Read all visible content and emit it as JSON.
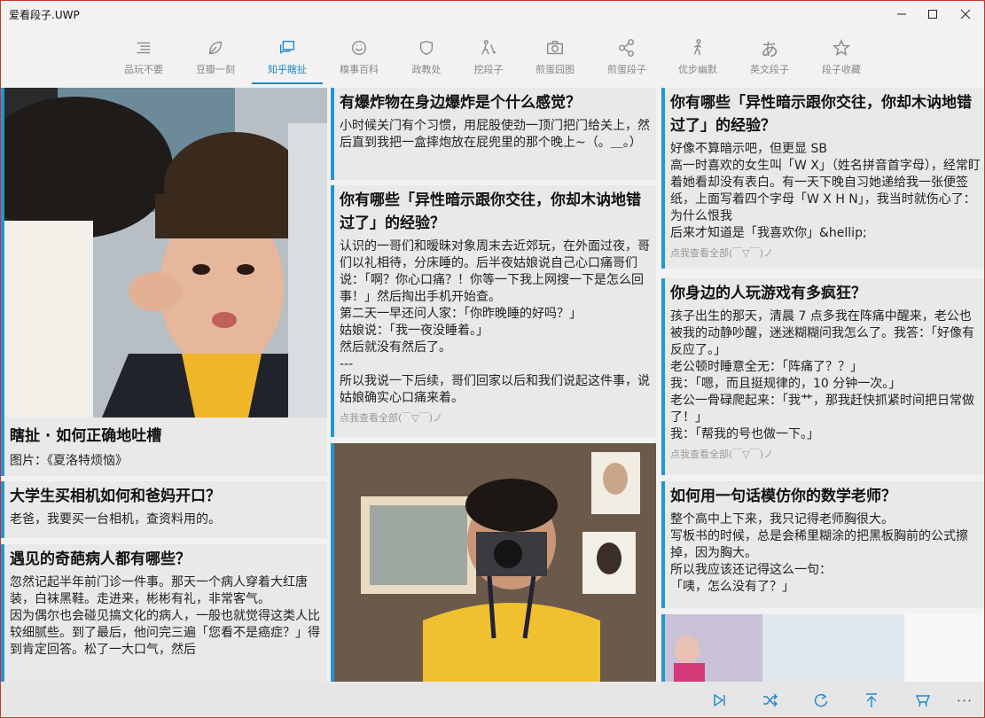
{
  "app": {
    "title": "爱看段子.UWP"
  },
  "window_buttons": [
    "minimize",
    "maximize",
    "close"
  ],
  "nav": {
    "items": [
      {
        "label": "品玩不要",
        "icon": "list-icon"
      },
      {
        "label": "豆瓣一刻",
        "icon": "leaf-icon"
      },
      {
        "label": "知乎瞎扯",
        "icon": "chat-icon",
        "active": true
      },
      {
        "label": "糗事百科",
        "icon": "smile-icon"
      },
      {
        "label": "政教处",
        "icon": "shield-icon"
      },
      {
        "label": "挖段子",
        "icon": "shovel-icon"
      },
      {
        "label": "煎蛋囧图",
        "icon": "camera-icon"
      },
      {
        "label": "煎蛋段子",
        "icon": "share-icon"
      },
      {
        "label": "优步幽默",
        "icon": "walk-icon"
      },
      {
        "label": "英文段子",
        "icon": "kana-icon"
      },
      {
        "label": "段子收藏",
        "icon": "star-icon"
      }
    ]
  },
  "col1": {
    "feature": {
      "title": "瞎扯 · 如何正确地吐槽",
      "caption": "图片：《夏洛特烦恼》"
    },
    "card2": {
      "title": "大学生买相机如何和爸妈开口？",
      "body": "老爸，我要买一台相机，查资料用的。"
    },
    "card3": {
      "title": "遇见的奇葩病人都有哪些？",
      "body": "忽然记起半年前门诊一件事。那天一个病人穿着大红唐装，白袜黑鞋。走进来，彬彬有礼，非常客气。\n因为偶尔也会碰见搞文化的病人，一般也就觉得这类人比较细腻些。到了最后，他问完三遍「您看不是癌症？」得到肯定回答。松了一大口气，然后"
    }
  },
  "col2": {
    "card1": {
      "title": "有爆炸物在身边爆炸是个什么感觉？",
      "body": "小时候关门有个习惯，用屁股使劲一顶门把门给关上，然后直到我把一盒摔炮放在屁兜里的那个晚上~（。＿。）"
    },
    "card2": {
      "title": "你有哪些「异性暗示跟你交往，你却木讷地错过了」的经验？",
      "body": "认识的一哥们和暧昧对象周末去近郊玩，在外面过夜，哥们以礼相待，分床睡的。后半夜姑娘说自己心口痛哥们说：「啊？你心口痛？！你等一下我上网搜一下是怎么回事！」然后掏出手机开始查。\n第二天一早还问人家：「你昨晚睡的好吗？」\n姑娘说：「我一夜没睡着。」\n然后就没有然后了。\n---\n所以我说一下后续，哥们回家以后和我们说起这件事，说姑娘确实心口痛来着。",
      "more": "点我查看全部(￣▽￣)ノ"
    }
  },
  "col3": {
    "card1": {
      "title": "你有哪些「异性暗示跟你交往，你却木讷地错过了」的经验？",
      "body": "好像不算暗示吧，但更显 SB\n高一时喜欢的女生叫「W X」（姓名拼音首字母），经常盯着她看却没有表白。有一天下晚自习她递给我一张便签纸，上面写着四个字母「W X H N」，我当时就伤心了：为什么恨我\n后来才知道是「我喜欢你」&hellip;",
      "more": "点我查看全部(￣▽￣)ノ"
    },
    "card2": {
      "title": "你身边的人玩游戏有多疯狂？",
      "body": "孩子出生的那天，清晨 7 点多我在阵痛中醒来，老公也被我的动静吵醒，迷迷糊糊问我怎么了。我答：「好像有反应了。」\n老公顿时睡意全无：「阵痛了？？」\n我：「嗯，而且挺规律的，10 分钟一次。」\n老公一骨碌爬起来：「我艹，那我赶快抓紧时间把日常做了！」\n我：「帮我的号也做一下。」",
      "more": "点我查看全部(￣▽￣)ノ"
    },
    "card3": {
      "title": "如何用一句话模仿你的数学老师？",
      "body": "整个高中上下来，我只记得老师胸很大。\n写板书的时候，总是会稀里糊涂的把黑板胸前的公式擦掉，因为胸大。\n所以我应该还记得这么一句：\n「咦，怎么没有了？」"
    }
  },
  "bottom": {
    "buttons": [
      "skip-next-icon",
      "shuffle-icon",
      "refresh-icon",
      "to-top-icon",
      "clean-icon",
      "more-icon"
    ]
  },
  "colors": {
    "accent": "#1e88c8",
    "card_border": "#2196d3",
    "background": "#f2f2f2"
  }
}
